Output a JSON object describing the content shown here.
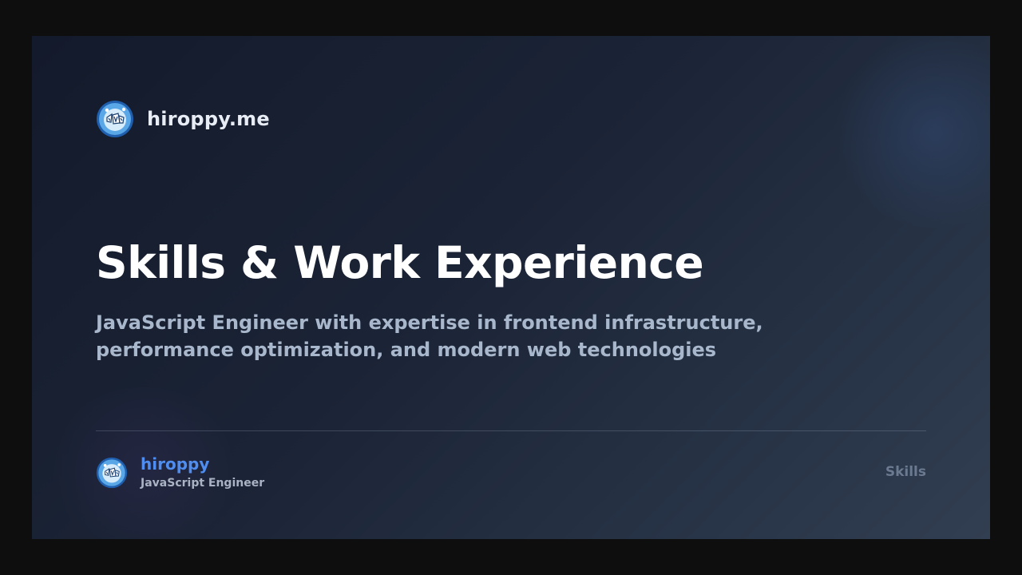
{
  "site": {
    "name": "hiroppy.me",
    "avatar_icon": "hiroppy-avatar-icon"
  },
  "hero": {
    "title": "Skills & Work Experience",
    "subtitle": "JavaScript Engineer with expertise in frontend infrastructure, performance optimization, and modern web technologies"
  },
  "author": {
    "name": "hiroppy",
    "role": "JavaScript Engineer",
    "avatar_icon": "hiroppy-avatar-icon"
  },
  "section_tag": "Skills",
  "colors": {
    "background": "#1b2436",
    "accent": "#4f8ef0",
    "title": "#ffffff",
    "subtitle": "#a9b7cc",
    "muted": "#6b7a90"
  }
}
